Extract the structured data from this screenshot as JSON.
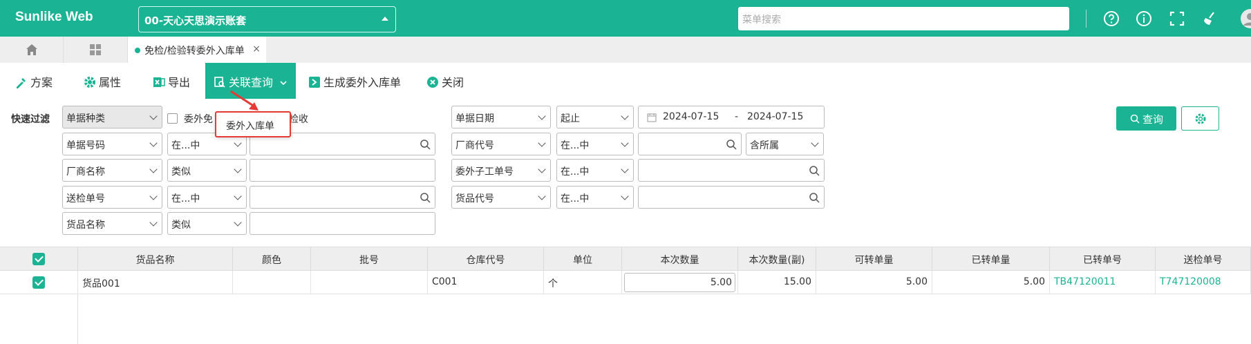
{
  "app": {
    "brand": "Sunlike Web",
    "account": "00-天心天思演示账套",
    "menu_search_placeholder": "菜单搜索"
  },
  "tabs": [
    {
      "label": "免检/检验转委外入库单",
      "close": "×"
    }
  ],
  "toolbar": [
    {
      "label": "方案",
      "icon": "scheme-icon"
    },
    {
      "label": "属性",
      "icon": "gear-icon"
    },
    {
      "label": "导出",
      "icon": "excel-icon"
    },
    {
      "label": "关联查询",
      "icon": "link-query-icon"
    },
    {
      "label": "生成委外入库单",
      "icon": "generate-icon"
    },
    {
      "label": "关闭",
      "icon": "close-circle-icon"
    }
  ],
  "dropdown": {
    "item": "委外入库单"
  },
  "filter": {
    "quick_label": "快速过滤",
    "doc_type": "单据种类",
    "check1_label": "委外免",
    "check2_label": "检收",
    "doc_no": "单据号码",
    "vendor_name": "厂商名称",
    "inspect_no": "送检单号",
    "goods_name": "货品名称",
    "op_in": "在...中",
    "op_like": "类似",
    "doc_date": "单据日期",
    "range": "起止",
    "date_from": "2024-07-15",
    "date_sep": "-",
    "date_to": "2024-07-15",
    "vendor_code": "厂商代号",
    "sub_order": "委外子工单号",
    "goods_code": "货品代号",
    "include_sub": "含所属",
    "query_btn": "查询"
  },
  "grid": {
    "headers": [
      "货品名称",
      "颜色",
      "批号",
      "仓库代号",
      "单位",
      "本次数量",
      "本次数量(副)",
      "可转单量",
      "已转单量",
      "已转单号",
      "送检单号"
    ],
    "rows": [
      {
        "goods": "货品001",
        "color": "",
        "batch": "",
        "wh": "C001",
        "unit": "个",
        "qty": "5.00",
        "qty2": "15.00",
        "can": "5.00",
        "done": "5.00",
        "done_no": "TB47120011",
        "insp_no": "T747120008"
      }
    ]
  },
  "colors": {
    "accent": "#1ab394",
    "highlight": "#e53935"
  }
}
